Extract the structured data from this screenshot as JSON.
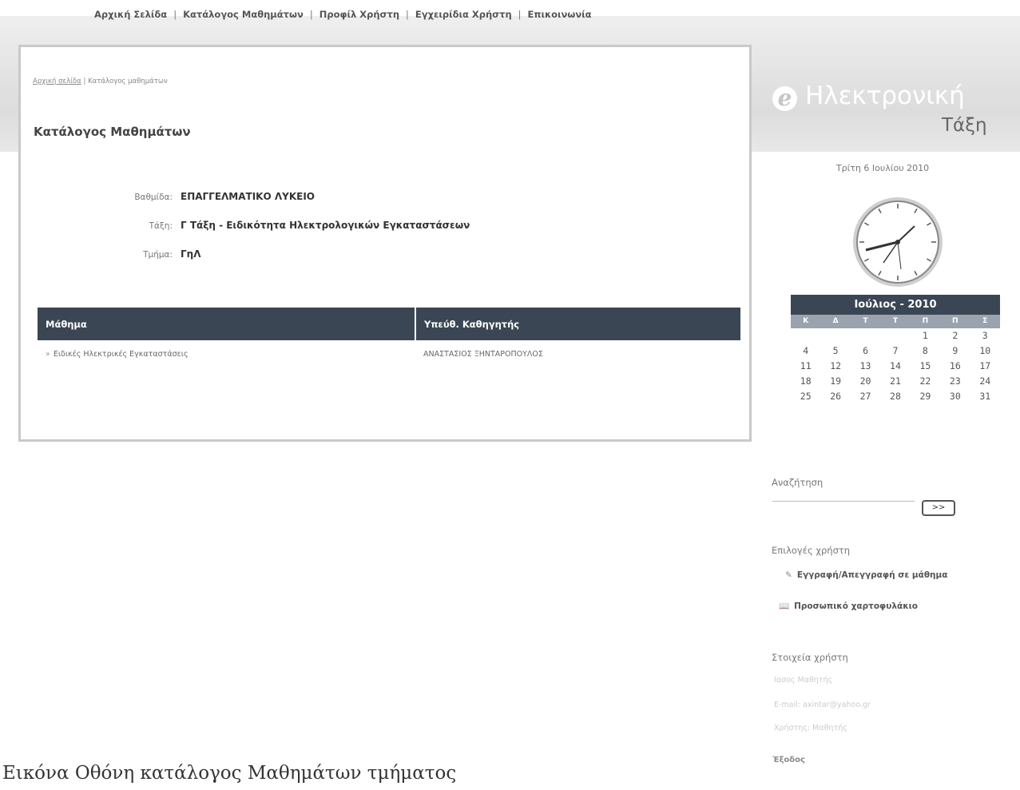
{
  "topnav": {
    "items": [
      "Αρχική Σελίδα",
      "Κατάλογος Μαθημάτων",
      "Προφίλ Χρήστη",
      "Εγχειρίδια Χρήστη",
      "Επικοινωνία"
    ],
    "separator": "|"
  },
  "breadcrumb": {
    "home": "Αρχική σελίδα",
    "separator": "|",
    "current": "Κατάλογος μαθημάτων"
  },
  "page_title": "Κατάλογος Μαθημάτων",
  "info": {
    "level_label": "Βαθμίδα:",
    "level_value": "ΕΠΑΓΓΕΛΜΑΤΙΚΟ ΛΥΚΕΙΟ",
    "class_label": "Τάξη:",
    "class_value": "Γ Τάξη - Ειδικότητα Ηλεκτρολογικών Εγκαταστάσεων",
    "section_label": "Τμήμα:",
    "section_value": "ΓηΛ"
  },
  "courses": {
    "headers": [
      "Μάθημα",
      "Υπεύθ. Καθηγητής"
    ],
    "rows": [
      {
        "bullet": "»",
        "course": "Ειδικές Ηλεκτρικές Εγκαταστάσεις",
        "teacher": "ΑΝΑΣΤΑΣΙΟΣ ΞΗΝΤΑΡΟΠΟΥΛΟΣ"
      }
    ]
  },
  "logo": {
    "line1": "Ηλεκτρονική",
    "line2": "Τάξη",
    "mark": "e"
  },
  "date": "Τρίτη 6 Ιουλίου 2010",
  "calendar": {
    "title": "Ιούλιος - 2010",
    "weekdays": [
      "Κ",
      "Δ",
      "Τ",
      "Τ",
      "Π",
      "Π",
      "Σ"
    ],
    "weeks": [
      [
        "",
        "",
        "",
        "",
        "1",
        "2",
        "3"
      ],
      [
        "4",
        "5",
        "6",
        "7",
        "8",
        "9",
        "10"
      ],
      [
        "11",
        "12",
        "13",
        "14",
        "15",
        "16",
        "17"
      ],
      [
        "18",
        "19",
        "20",
        "21",
        "22",
        "23",
        "24"
      ],
      [
        "25",
        "26",
        "27",
        "28",
        "29",
        "30",
        "31"
      ]
    ]
  },
  "search": {
    "label": "Αναζήτηση",
    "button": ">>"
  },
  "options": {
    "label": "Επιλογές χρήστη",
    "items": [
      "Εγγραφή/Απεγγραφή σε μάθημα",
      "Προσωπικό χαρτοφυλάκιο"
    ]
  },
  "user_info": {
    "label": "Στοιχεία χρήστη",
    "name": "Ιασος Μαθητής",
    "email": "E-mail: axintar@yahoo.gr",
    "role": "Χρήστης: Μαθητής",
    "logout": "Έξοδος"
  },
  "caption": "Εικόνα Οθόνη κατάλογος Μαθημάτων τμήματος"
}
